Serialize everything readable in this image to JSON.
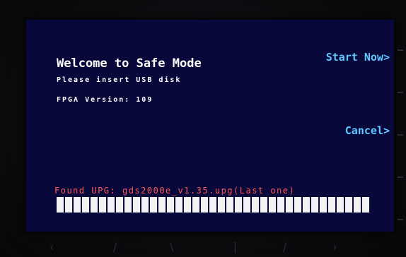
{
  "screen": {
    "title": "Welcome to Safe Mode",
    "instruction": "Please insert USB disk",
    "fpga_version": "FPGA Version: 109",
    "status": "Found UPG: gds2000e_v1.35.upg(Last one)",
    "progress_segments": 37,
    "progress_fraction": 1.0
  },
  "softkeys": {
    "start": "Start Now>",
    "cancel": "Cancel>"
  },
  "colors": {
    "screen_bg": "#08083a",
    "softkey": "#5ec8ff",
    "status": "#ff5a5a",
    "text": "#ffffff"
  }
}
